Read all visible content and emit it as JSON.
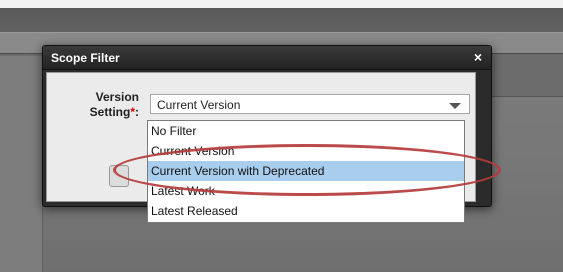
{
  "dialog": {
    "title": "Scope Filter",
    "close_label": "×",
    "field": {
      "label_line1": "Version",
      "label_line2": "Setting",
      "required_mark": "*",
      "label_colon": ":"
    },
    "select": {
      "value": "Current Version",
      "options": [
        "No Filter",
        "Current Version",
        "Current Version with Deprecated",
        "Latest Work",
        "Latest Released"
      ],
      "highlighted_index": 2
    }
  },
  "colors": {
    "dialog_header": "#2b2b2b",
    "selected_option": "#a9cdec",
    "required": "#e00000",
    "annotation": "#b53b3b"
  }
}
